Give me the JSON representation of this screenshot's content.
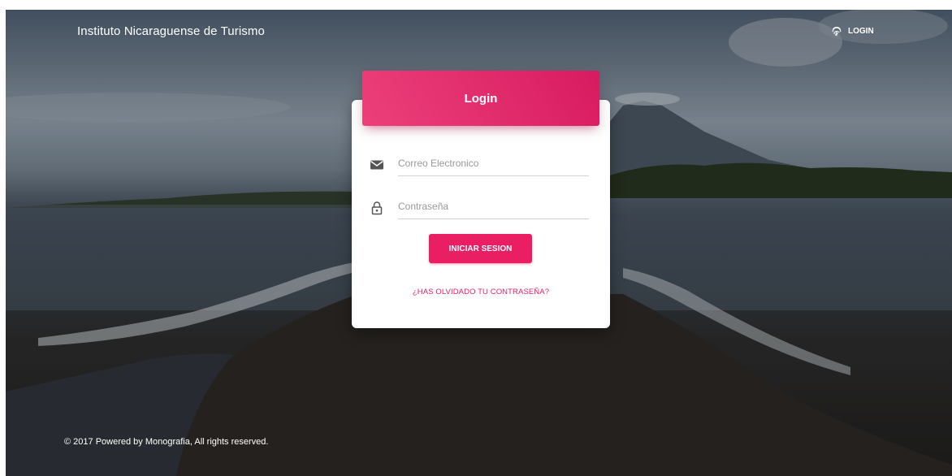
{
  "header": {
    "brand": "Instituto Nicaraguense de Turismo",
    "login_link": "LOGIN",
    "login_icon": "fingerprint-icon"
  },
  "login_card": {
    "title": "Login",
    "email": {
      "placeholder": "Correo Electronico",
      "icon": "email-icon",
      "value": ""
    },
    "password": {
      "placeholder": "Contraseña",
      "icon": "lock-icon",
      "value": ""
    },
    "submit_label": "INICIAR SESION",
    "forgot_label": "¿HAS OLVIDADO TU CONTRASEÑA?"
  },
  "footer": {
    "copyright": "© 2017 Powered by Monografia, All rights reserved."
  },
  "colors": {
    "accent": "#e91e63",
    "accent_light": "#ec407a",
    "card_bg": "#ffffff"
  }
}
